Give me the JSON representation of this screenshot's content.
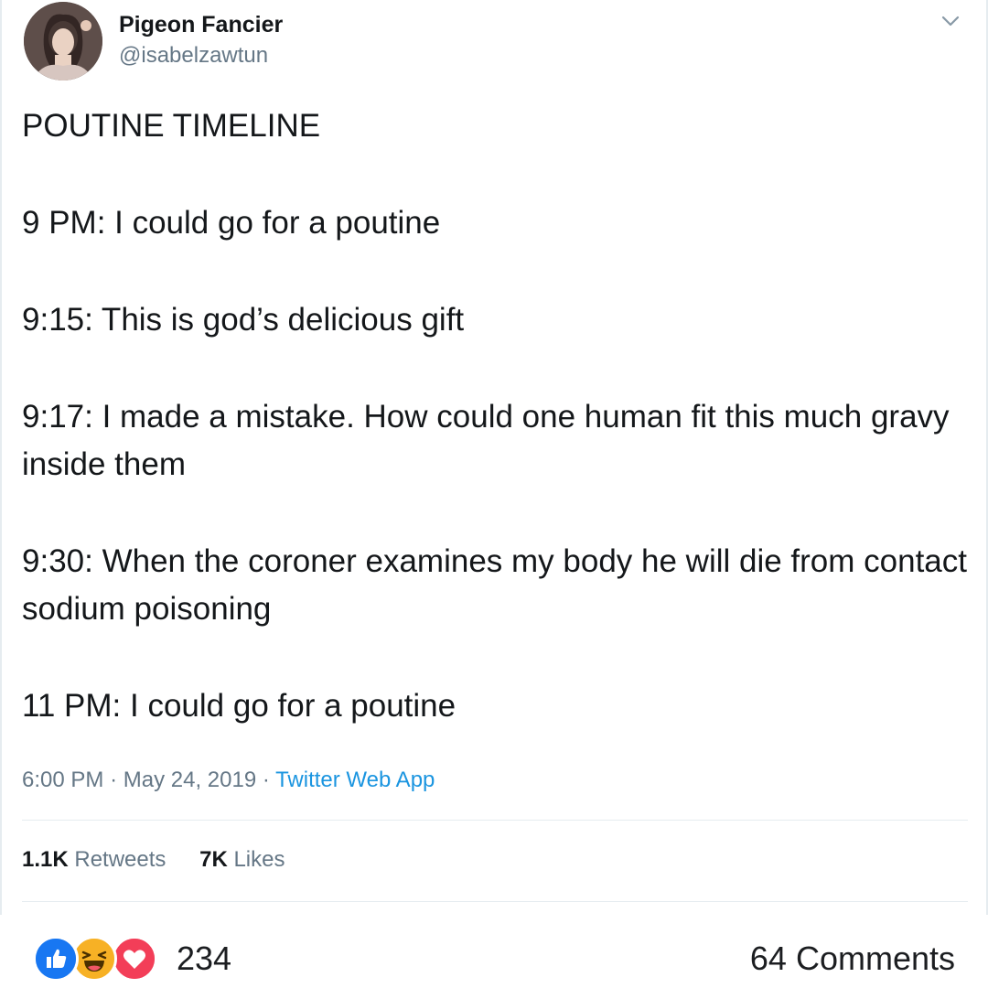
{
  "tweet": {
    "author": {
      "display_name": "Pigeon Fancier",
      "handle": "@isabelzawtun"
    },
    "lines": [
      "POUTINE TIMELINE",
      "9 PM: I could go for a poutine",
      "9:15: This is god’s delicious gift",
      "9:17: I made a mistake. How could one human fit this much gravy inside them",
      "9:30: When the coroner examines my body he will die from contact sodium poisoning",
      "11 PM: I could go for a poutine"
    ],
    "time": "6:00 PM",
    "date": "May 24, 2019",
    "separator": "·",
    "source": "Twitter Web App",
    "retweets_count": "1.1K",
    "retweets_label": "Retweets",
    "likes_count": "7K",
    "likes_label": "Likes"
  },
  "facebook_bar": {
    "reactions": [
      "like-icon",
      "haha-icon",
      "love-icon"
    ],
    "reaction_count": "234",
    "comments_label": "64 Comments"
  },
  "colors": {
    "text": "#14171a",
    "secondary": "#657786",
    "link": "#1b95e0",
    "like_blue": "#1877f2",
    "haha_yellow": "#f7b125",
    "love_red": "#f33e58"
  }
}
